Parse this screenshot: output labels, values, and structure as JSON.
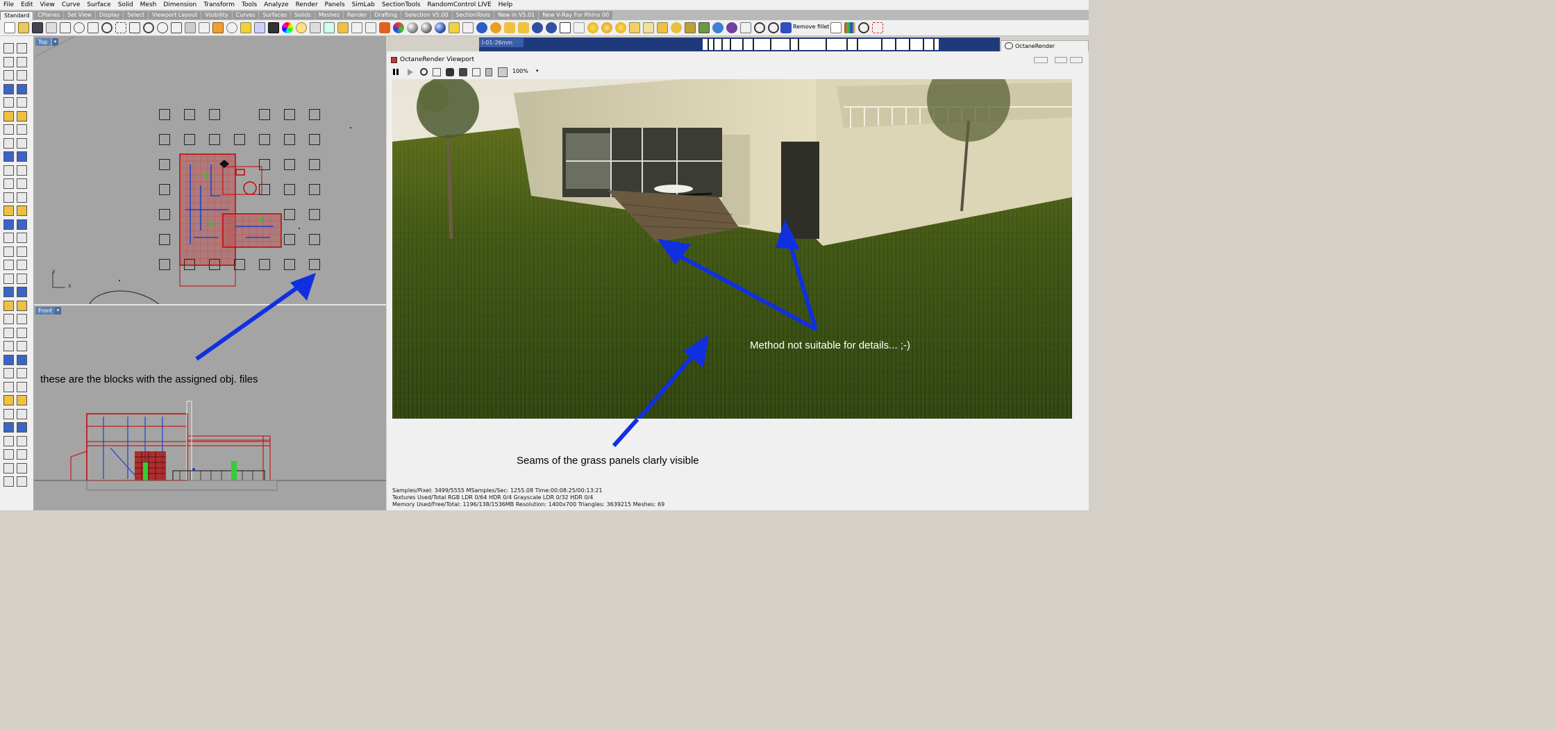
{
  "menu": [
    "File",
    "Edit",
    "View",
    "Curve",
    "Surface",
    "Solid",
    "Mesh",
    "Dimension",
    "Transform",
    "Tools",
    "Analyze",
    "Render",
    "Panels",
    "SimLab",
    "SectionTools",
    "RandomControl LIVE",
    "Help"
  ],
  "tabs": [
    "Standard",
    "CPlanes",
    "Set View",
    "Display",
    "Select",
    "Viewport Layout",
    "Visibility",
    "Curves",
    "Surfaces",
    "Solids",
    "Meshes",
    "Render",
    "Drafting",
    "Selection V5.00",
    "SectionTools",
    "New in V5.01",
    "New V-Ray For Rhino 00"
  ],
  "toolbar": {
    "remove_fillet_label": "Remove fillet"
  },
  "viewports": {
    "top": {
      "label": "Top",
      "axis_y": "y",
      "axis_x": "x"
    },
    "front": {
      "label": "Front"
    }
  },
  "layer_strip": {
    "label": "I-01-26mm"
  },
  "octane": {
    "tab_label": "OctaneRender",
    "title": "OctaneRender Viewport",
    "zoom": "100%",
    "status_line1": "Samples/Pixel: 3499/5555  MSamples/Sec: 1255.08  Time:00:08:25/00:13:21",
    "status_line2": "Textures Used/Total RGB LDR 0/64  HDR 0/4  Grayscale LDR 0/32  HDR 0/4",
    "status_line3": "Memory Used/Free/Total: 1196/138/1536MB  Resolution: 1400x700  Triangles: 3639215  Meshes:  69"
  },
  "annotations": {
    "blocks": "these are the blocks with the assigned obj. files",
    "method": "Method not suitable for details... ;-)",
    "seams": "Seams of the grass panels clarly visible"
  },
  "colors": {
    "arrow": "#1030e0",
    "viewport_label": "#5b7fb5"
  }
}
